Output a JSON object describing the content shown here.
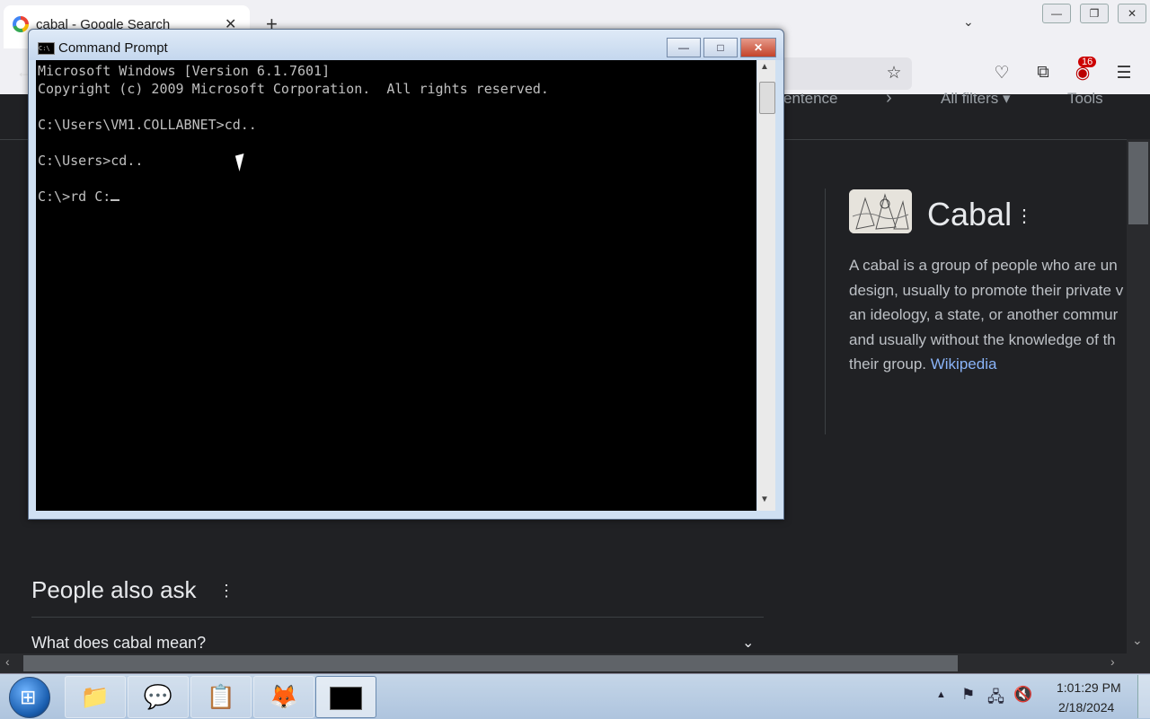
{
  "browser": {
    "tab_title": "cabal - Google Search",
    "tab_close": "✕",
    "new_tab": "+",
    "tab_list": "⌄",
    "win_minimize": "—",
    "win_restore": "❐",
    "win_close": "✕",
    "extension_badge": "16",
    "back": "←"
  },
  "google": {
    "tabs_partial": "entence",
    "tabs_next": "›",
    "all_filters": "All filters ▾",
    "tools": "Tools",
    "kp_title": "Cabal",
    "kp_dots": "⋮",
    "kp_desc_lines": [
      "A cabal is a group of people who are un",
      "design, usually to promote their private v",
      "an ideology, a state, or another commur",
      "and usually without the knowledge of th",
      "their group."
    ],
    "kp_link": "Wikipedia",
    "paa_title": "People also ask",
    "paa_dots": "⋮",
    "paa_q1": "What does cabal mean?",
    "paa_chev": "⌄"
  },
  "cmd": {
    "title": "Command Prompt",
    "icon_text": "C:\\",
    "minimize": "—",
    "maximize": "□",
    "close": "✕",
    "lines": [
      "Microsoft Windows [Version 6.1.7601]",
      "Copyright (c) 2009 Microsoft Corporation.  All rights reserved.",
      "",
      "C:\\Users\\VM1.COLLABNET>cd..",
      "",
      "C:\\Users>cd..",
      "",
      "C:\\>rd C:"
    ]
  },
  "taskbar": {
    "items": [
      "file-explorer",
      "chat-app",
      "task-app",
      "firefox",
      "command-prompt"
    ],
    "tray_up": "▲",
    "time": "1:01:29 PM",
    "date": "2/18/2024"
  }
}
